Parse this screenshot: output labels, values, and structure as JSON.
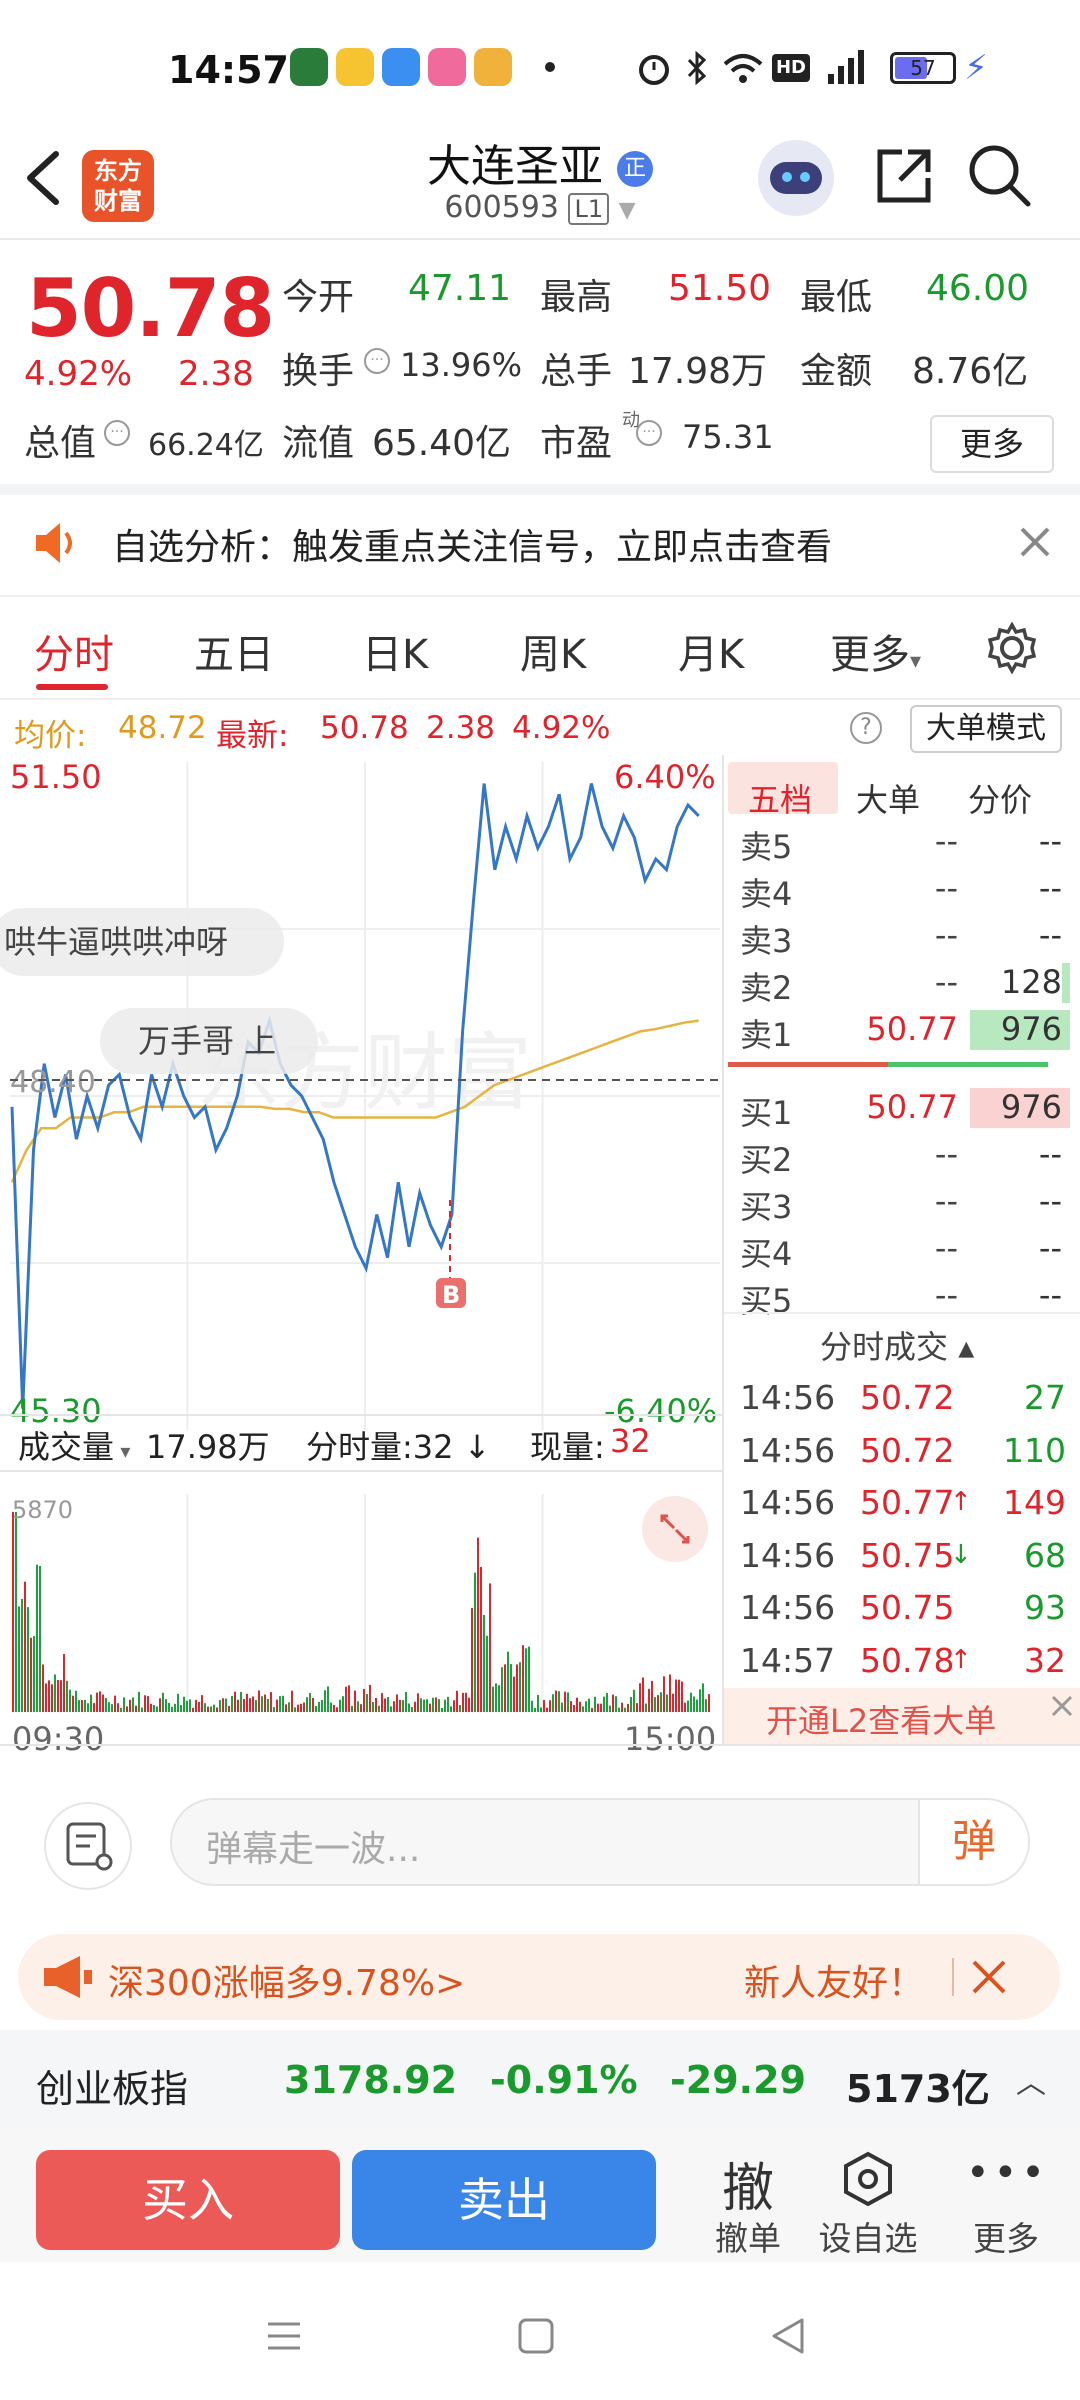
{
  "status_bar": {
    "time": "14:57",
    "battery": "57"
  },
  "header": {
    "logo_line1": "东方",
    "logo_line2": "财富",
    "title": "大连圣亚",
    "badge": "正",
    "code": "600593",
    "level": "L1"
  },
  "quote": {
    "price": "50.78",
    "change_pct": "4.92%",
    "change": "2.38",
    "total_value_label": "总值",
    "total_value": "66.24亿",
    "open_label": "今开",
    "open": "47.11",
    "high_label": "最高",
    "high": "51.50",
    "low_label": "最低",
    "low": "46.00",
    "turnover_label": "换手",
    "turnover": "13.96%",
    "volume_label": "总手",
    "volume": "17.98万",
    "amount_label": "金额",
    "amount": "8.76亿",
    "float_label": "流值",
    "float_value": "65.40亿",
    "pe_label": "市盈",
    "pe_sup": "动",
    "pe": "75.31",
    "more_button": "更多"
  },
  "notice": {
    "text": "自选分析：触发重点关注信号，立即点击查看"
  },
  "tabs": [
    {
      "label": "分时"
    },
    {
      "label": "五日"
    },
    {
      "label": "日K"
    },
    {
      "label": "周K"
    },
    {
      "label": "月K"
    },
    {
      "label": "更多"
    }
  ],
  "infobar": {
    "avg_label": "均价:",
    "avg": "48.72",
    "latest_label": "最新:",
    "latest": "50.78",
    "change": "2.38",
    "pct": "4.92%",
    "big_order_button": "大单模式"
  },
  "chart": {
    "top_price": "51.50",
    "top_pct": "6.40%",
    "bottom_price": "45.30",
    "bottom_pct": "-6.40%",
    "mid_price": "48.40",
    "comment1": "哄牛逼哄哄冲呀",
    "comment2": "万手哥 上",
    "buy_marker": "B",
    "watermark": "东方财富"
  },
  "chart_data": {
    "type": "line",
    "title": "",
    "x_start": "09:30",
    "x_end": "15:00",
    "ylim": [
      45.3,
      51.5
    ],
    "series": [
      {
        "values": [
          48.3,
          45.5,
          47.9,
          48.7,
          48.2,
          48.6,
          48.0,
          48.4,
          48.1,
          48.5,
          48.6,
          48.2,
          48.0,
          48.6,
          48.3,
          48.7,
          48.4,
          48.2,
          48.3,
          47.9,
          48.1,
          48.4,
          48.9,
          48.8,
          49.1,
          48.7,
          48.5,
          48.4,
          48.2,
          48.0,
          47.6,
          47.3,
          47.0,
          46.8,
          47.3,
          46.9,
          47.6,
          47.0,
          47.5,
          47.2,
          47.0,
          47.3,
          49.0,
          50.2,
          51.3,
          50.5,
          50.9,
          50.6,
          51.0,
          50.7,
          50.9,
          51.2,
          50.6,
          50.8,
          51.3,
          50.9,
          50.7,
          51.0,
          50.8,
          50.4,
          50.6,
          50.5,
          50.9,
          51.1,
          51.0
        ]
      },
      {
        "values": [
          47.6,
          47.9,
          48.1,
          48.1,
          48.2,
          48.2,
          48.2,
          48.25,
          48.25,
          48.3,
          48.3,
          48.3,
          48.3,
          48.3,
          48.3,
          48.3,
          48.3,
          48.3,
          48.28,
          48.28,
          48.25,
          48.25,
          48.2,
          48.2,
          48.2,
          48.2,
          48.2,
          48.2,
          48.2,
          48.2,
          48.25,
          48.3,
          48.4,
          48.5,
          48.55,
          48.6,
          48.65,
          48.7,
          48.75,
          48.8,
          48.85,
          48.9,
          48.95,
          49.0,
          49.02,
          49.05,
          49.08,
          49.1
        ]
      }
    ]
  },
  "volume": {
    "label": "成交量",
    "total": "17.98万",
    "minute_label": "分时量:",
    "minute_value": "32",
    "current_label": "现量:",
    "current": "32",
    "max": "5870",
    "time_start": "09:30",
    "time_end": "15:00"
  },
  "orderbook": {
    "tabs": [
      "五档",
      "大单",
      "分价"
    ],
    "asks": [
      {
        "label": "卖5",
        "price": "--",
        "vol": "--"
      },
      {
        "label": "卖4",
        "price": "--",
        "vol": "--"
      },
      {
        "label": "卖3",
        "price": "--",
        "vol": "--"
      },
      {
        "label": "卖2",
        "price": "--",
        "vol": "128"
      },
      {
        "label": "卖1",
        "price": "50.77",
        "vol": "976"
      }
    ],
    "bids": [
      {
        "label": "买1",
        "price": "50.77",
        "vol": "976"
      },
      {
        "label": "买2",
        "price": "--",
        "vol": "--"
      },
      {
        "label": "买3",
        "price": "--",
        "vol": "--"
      },
      {
        "label": "买4",
        "price": "--",
        "vol": "--"
      },
      {
        "label": "买5",
        "price": "--",
        "vol": "--"
      }
    ],
    "ticks_title": "分时成交",
    "ticks": [
      {
        "time": "14:56",
        "price": "50.72",
        "arrow": "",
        "vol": "27",
        "vcolor": "green"
      },
      {
        "time": "14:56",
        "price": "50.72",
        "arrow": "",
        "vol": "110",
        "vcolor": "green"
      },
      {
        "time": "14:56",
        "price": "50.77",
        "arrow": "↑",
        "vol": "149",
        "vcolor": "red"
      },
      {
        "time": "14:56",
        "price": "50.75",
        "arrow": "↓",
        "vol": "68",
        "vcolor": "green"
      },
      {
        "time": "14:56",
        "price": "50.75",
        "arrow": "",
        "vol": "93",
        "vcolor": "green"
      },
      {
        "time": "14:57",
        "price": "50.78",
        "arrow": "↑",
        "vol": "32",
        "vcolor": "red"
      }
    ],
    "l2_text": "开通L2查看大单"
  },
  "comment_bar": {
    "placeholder": "弹幕走一波...",
    "danmu_button": "弹"
  },
  "banner": {
    "text": "深300涨幅多9.78%>",
    "right": "新人友好！"
  },
  "index_bar": {
    "name": "创业板指",
    "value": "3178.92",
    "pct": "-0.91%",
    "change": "-29.29",
    "amount": "5173亿"
  },
  "actions": {
    "buy": "买入",
    "sell": "卖出",
    "cancel_icon": "撤",
    "cancel": "撤单",
    "watch": "设自选",
    "more": "更多"
  }
}
